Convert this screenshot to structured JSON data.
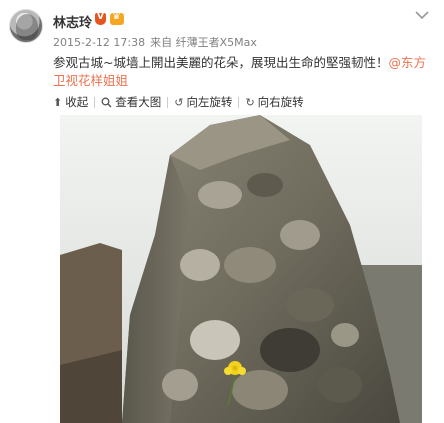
{
  "user": {
    "name": "林志玲"
  },
  "meta": {
    "timestamp": "2015-2-12 17:38",
    "source": "来自 纤薄王者X5Max"
  },
  "post": {
    "text": "参观古城~城墙上開出美麗的花朵，展現出生命的堅强韧性！",
    "mention": "@东方卫视花样姐姐"
  },
  "toolbar": {
    "collapse": "收起",
    "view_large": "查看大图",
    "rotate_left": "向左旋转",
    "rotate_right": "向右旋转"
  },
  "icons": {
    "collapse": "arrow-up-icon",
    "view_large": "magnifier-icon",
    "rotate_left": "rotate-left-icon",
    "rotate_right": "rotate-right-icon"
  },
  "colors": {
    "mention": "#eb7350",
    "badge_v": "#e8541e",
    "badge_crown": "#f5a623",
    "meta": "#808080"
  }
}
